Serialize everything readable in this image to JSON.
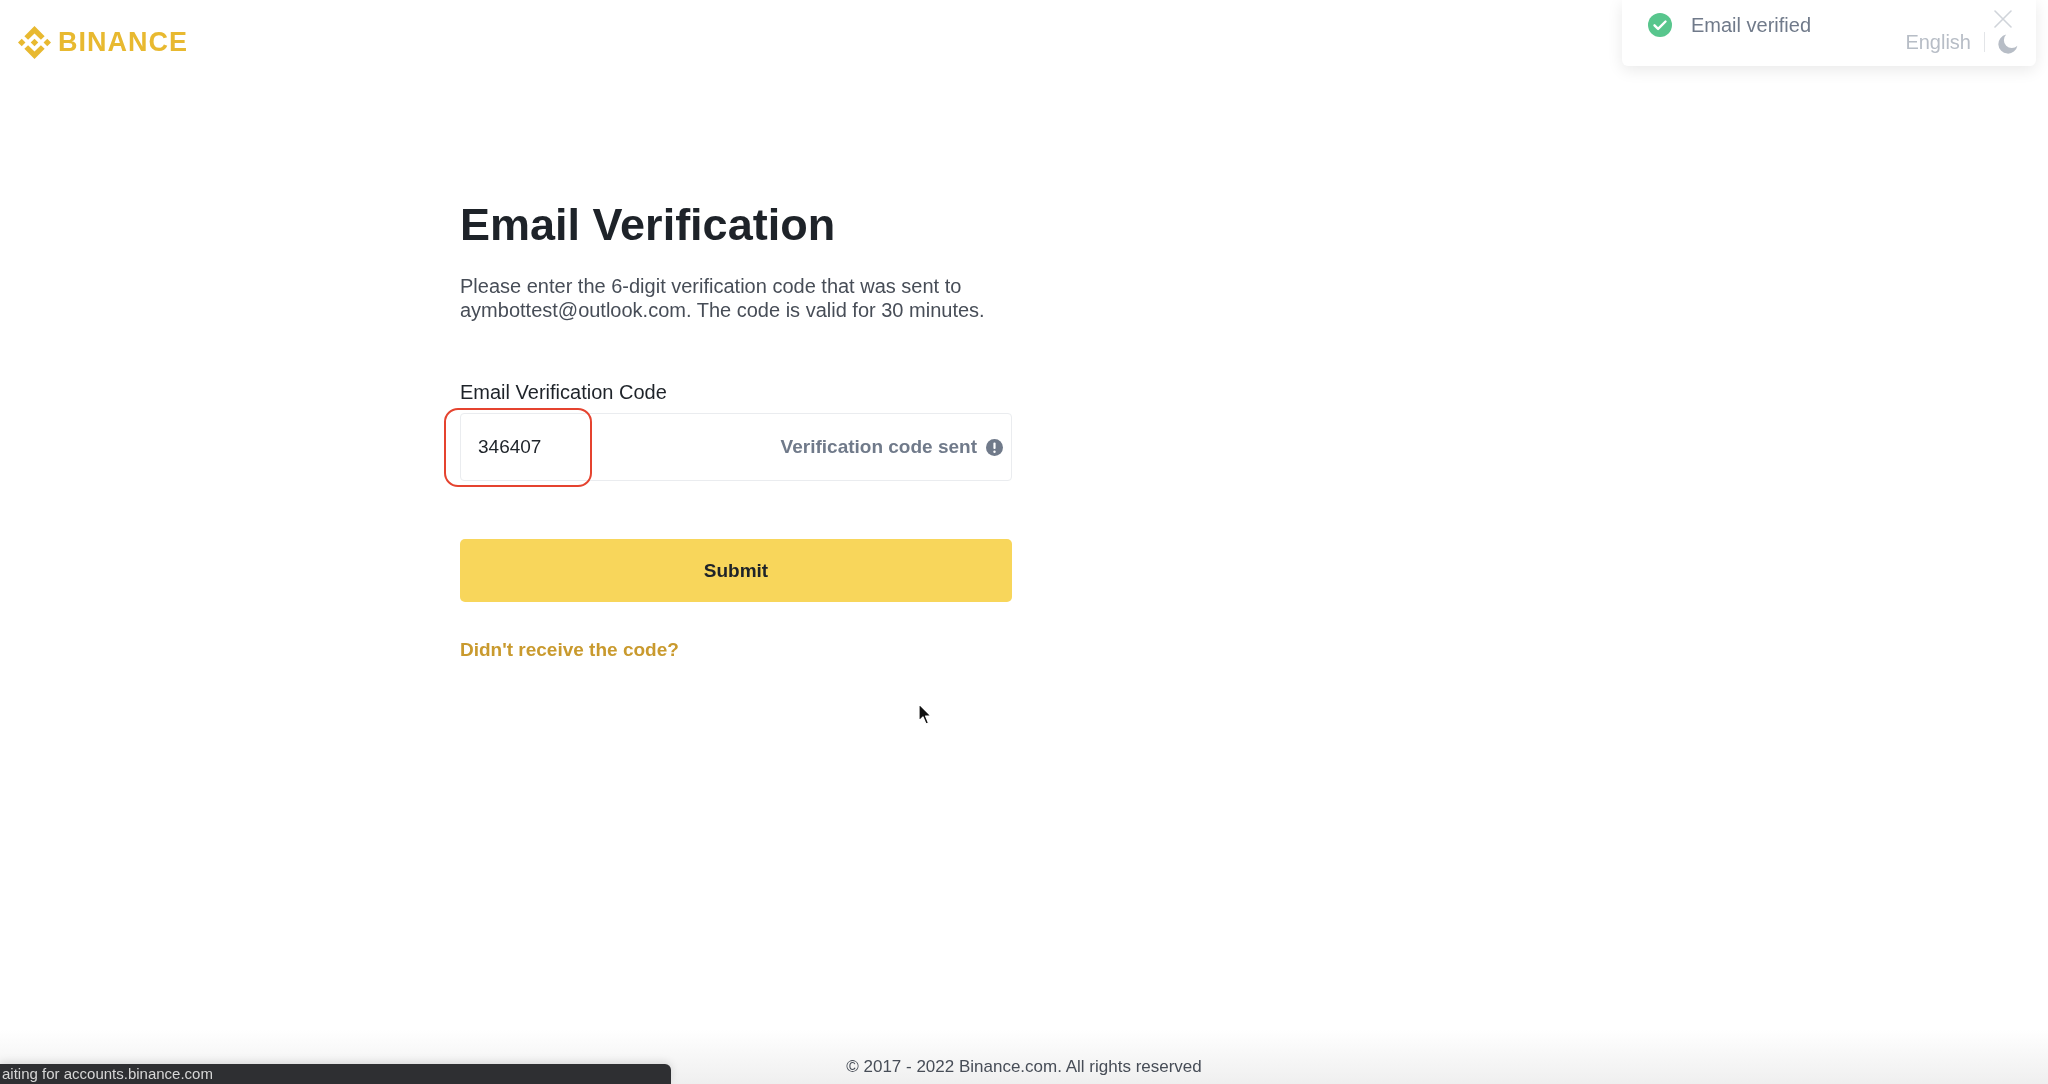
{
  "header": {
    "logo": "BINANCE",
    "language": "English"
  },
  "toast": {
    "message": "Email verified",
    "success": true
  },
  "form": {
    "title": "Email Verification",
    "description": "Please enter the 6-digit verification code that was sent to aymbottest@outlook.com. The code is valid for 30 minutes.",
    "code_field": {
      "label": "Email Verification Code",
      "value": "346407",
      "status": "Verification code sent",
      "highlighted": true
    },
    "submit": "Submit",
    "resend_link": "Didn't receive the code?"
  },
  "footer": {
    "copyright": "© 2017 - 2022 Binance.com. All rights reserved"
  },
  "status_bar": {
    "text": "aiting for accounts.binance.com"
  }
}
